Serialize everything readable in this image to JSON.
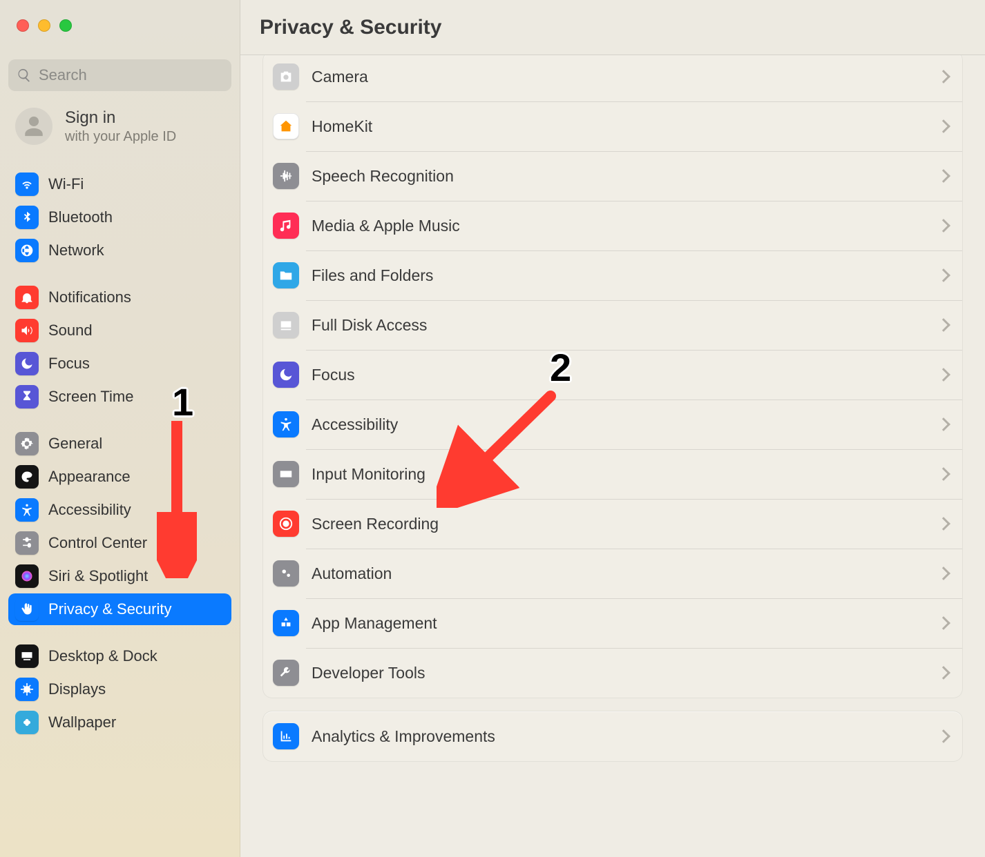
{
  "search": {
    "placeholder": "Search"
  },
  "account": {
    "title": "Sign in",
    "subtitle": "with your Apple ID"
  },
  "sidebar": {
    "groups": [
      [
        {
          "label": "Wi-Fi",
          "icon": "wifi",
          "color": "#0a7aff"
        },
        {
          "label": "Bluetooth",
          "icon": "bluetooth",
          "color": "#0a7aff"
        },
        {
          "label": "Network",
          "icon": "globe",
          "color": "#0a7aff"
        }
      ],
      [
        {
          "label": "Notifications",
          "icon": "bell",
          "color": "#ff3b30"
        },
        {
          "label": "Sound",
          "icon": "sound",
          "color": "#ff3b30"
        },
        {
          "label": "Focus",
          "icon": "moon",
          "color": "#5856d6"
        },
        {
          "label": "Screen Time",
          "icon": "hourglass",
          "color": "#5856d6"
        }
      ],
      [
        {
          "label": "General",
          "icon": "gear",
          "color": "#8e8e93"
        },
        {
          "label": "Appearance",
          "icon": "appearance",
          "color": "#141414"
        },
        {
          "label": "Accessibility",
          "icon": "access",
          "color": "#0a7aff"
        },
        {
          "label": "Control Center",
          "icon": "controls",
          "color": "#8e8e93"
        },
        {
          "label": "Siri & Spotlight",
          "icon": "siri",
          "color": "#141414"
        },
        {
          "label": "Privacy & Security",
          "icon": "hand",
          "color": "#0a7aff",
          "active": true
        }
      ],
      [
        {
          "label": "Desktop & Dock",
          "icon": "dock",
          "color": "#141414"
        },
        {
          "label": "Displays",
          "icon": "sun",
          "color": "#0a7aff"
        },
        {
          "label": "Wallpaper",
          "icon": "flower",
          "color": "#34aadc"
        }
      ]
    ]
  },
  "header": {
    "title": "Privacy & Security"
  },
  "settings": [
    {
      "label": "Camera",
      "icon": "camera",
      "color": "#cfcfcf"
    },
    {
      "label": "HomeKit",
      "icon": "home",
      "color": "#ffffff",
      "glyphColor": "#ff9500"
    },
    {
      "label": "Speech Recognition",
      "icon": "waveform",
      "color": "#8e8e93"
    },
    {
      "label": "Media & Apple Music",
      "icon": "music",
      "color": "#ff2d55"
    },
    {
      "label": "Files and Folders",
      "icon": "folder",
      "color": "#2fa7e7"
    },
    {
      "label": "Full Disk Access",
      "icon": "disk",
      "color": "#cfcfcf"
    },
    {
      "label": "Focus",
      "icon": "moon",
      "color": "#5856d6"
    },
    {
      "label": "Accessibility",
      "icon": "access",
      "color": "#0a7aff"
    },
    {
      "label": "Input Monitoring",
      "icon": "keyboard",
      "color": "#8e8e93"
    },
    {
      "label": "Screen Recording",
      "icon": "record",
      "color": "#ff3b30"
    },
    {
      "label": "Automation",
      "icon": "gears",
      "color": "#8e8e93"
    },
    {
      "label": "App Management",
      "icon": "apps",
      "color": "#0a7aff"
    },
    {
      "label": "Developer Tools",
      "icon": "tools",
      "color": "#8e8e93"
    }
  ],
  "settings2": [
    {
      "label": "Analytics & Improvements",
      "icon": "chart",
      "color": "#0a7aff"
    }
  ],
  "annotations": {
    "one": "1",
    "two": "2"
  }
}
